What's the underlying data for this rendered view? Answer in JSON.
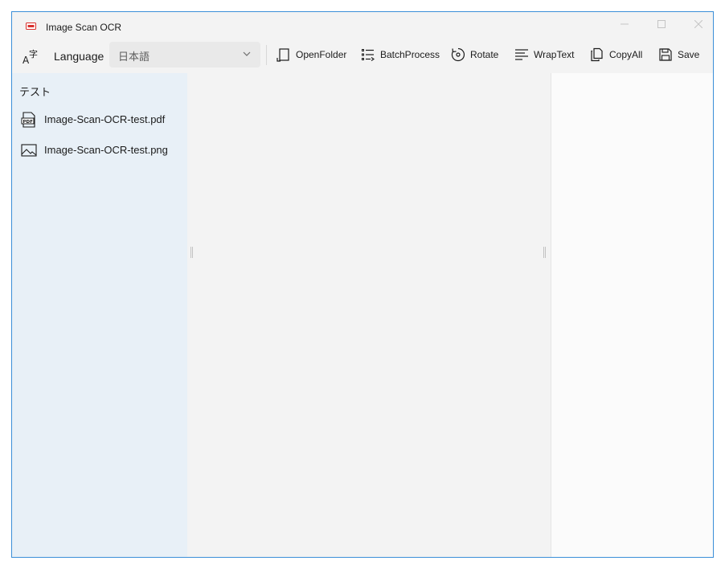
{
  "window": {
    "title": "Image Scan OCR",
    "accent_color": "#3b8fd8",
    "app_icon": "scanner-app-icon",
    "controls": [
      "minimize-icon",
      "maximize-icon",
      "close-icon"
    ]
  },
  "toolbar": {
    "language_icon": "language-icon",
    "language_label": "Language",
    "language_selected": "日本語",
    "buttons": [
      {
        "label": "OpenFolder",
        "icon": "open-folder-icon"
      },
      {
        "label": "BatchProcess",
        "icon": "batch-list-icon"
      },
      {
        "label": "Rotate",
        "icon": "rotate-icon"
      },
      {
        "label": "WrapText",
        "icon": "wrap-text-icon"
      },
      {
        "label": "CopyAll",
        "icon": "copy-icon"
      },
      {
        "label": "Save",
        "icon": "save-icon"
      }
    ]
  },
  "sidebar": {
    "folder_name": "テスト",
    "background": "#e8f0f7",
    "files": [
      {
        "name": "Image-Scan-OCR-test.pdf",
        "icon": "pdf-file-icon"
      },
      {
        "name": "Image-Scan-OCR-test.png",
        "icon": "image-file-icon"
      }
    ]
  }
}
